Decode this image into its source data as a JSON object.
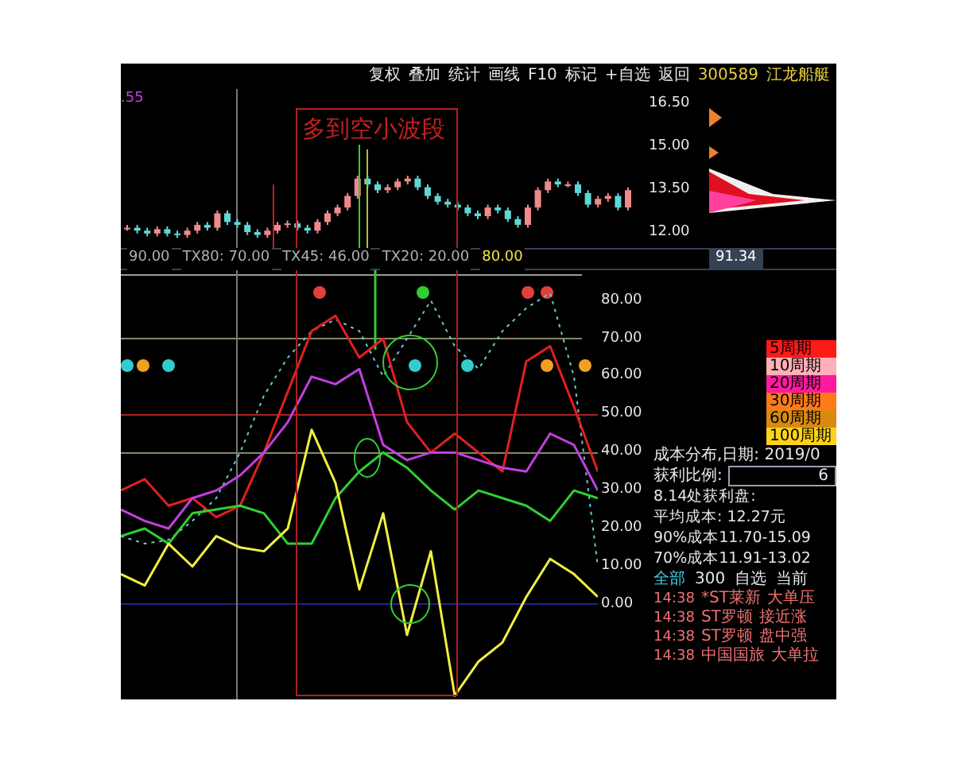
{
  "menu": [
    {
      "label": "复权"
    },
    {
      "label": "叠加"
    },
    {
      "label": "统计"
    },
    {
      "label": "画线"
    },
    {
      "label": "F10"
    },
    {
      "label": "标记"
    },
    {
      "label": "+自选"
    },
    {
      "label": "返回"
    }
  ],
  "stock": {
    "code": "300589",
    "name": "江龙船艇"
  },
  "price_chart": {
    "corner_value": ".55",
    "chart_data": {
      "type": "candlestick",
      "ylim": [
        11.5,
        17
      ],
      "yticks": [
        {
          "value": 16.5,
          "label": "16.50"
        },
        {
          "value": 15,
          "label": "15.00"
        },
        {
          "value": 13.5,
          "label": "13.50"
        },
        {
          "value": 12,
          "label": "12.00"
        }
      ],
      "ohlc": [
        [
          12.15,
          12.3,
          12.1,
          12.2
        ],
        [
          12.2,
          12.3,
          12.0,
          12.1
        ],
        [
          12.1,
          12.2,
          11.9,
          12.0
        ],
        [
          12.0,
          12.25,
          11.9,
          12.15
        ],
        [
          12.15,
          12.25,
          11.9,
          12.0
        ],
        [
          12.0,
          12.1,
          11.85,
          11.95
        ],
        [
          11.95,
          12.2,
          11.85,
          12.1
        ],
        [
          12.1,
          12.4,
          12.0,
          12.3
        ],
        [
          12.3,
          12.4,
          12.1,
          12.2
        ],
        [
          12.2,
          12.8,
          12.1,
          12.7
        ],
        [
          12.7,
          12.8,
          12.3,
          12.4
        ],
        [
          12.4,
          12.5,
          12.2,
          12.3
        ],
        [
          12.3,
          12.4,
          11.95,
          12.05
        ],
        [
          12.05,
          12.15,
          11.85,
          11.95
        ],
        [
          11.95,
          12.2,
          11.85,
          12.1
        ],
        [
          12.1,
          12.4,
          12.0,
          12.3
        ],
        [
          12.3,
          12.45,
          12.2,
          12.35
        ],
        [
          12.35,
          12.45,
          12.1,
          12.2
        ],
        [
          12.2,
          12.3,
          12.0,
          12.1
        ],
        [
          12.1,
          12.5,
          12.0,
          12.4
        ],
        [
          12.4,
          12.8,
          12.3,
          12.7
        ],
        [
          12.7,
          13.0,
          12.6,
          12.9
        ],
        [
          12.9,
          13.4,
          12.8,
          13.3
        ],
        [
          13.3,
          14.0,
          13.2,
          13.9
        ],
        [
          13.9,
          14.0,
          13.6,
          13.7
        ],
        [
          13.7,
          13.8,
          13.4,
          13.5
        ],
        [
          13.5,
          13.7,
          13.4,
          13.6
        ],
        [
          13.6,
          13.9,
          13.5,
          13.8
        ],
        [
          13.8,
          14.0,
          13.7,
          13.9
        ],
        [
          13.9,
          14.0,
          13.5,
          13.6
        ],
        [
          13.6,
          13.7,
          13.2,
          13.3
        ],
        [
          13.3,
          13.4,
          13.0,
          13.1
        ],
        [
          13.1,
          13.2,
          12.9,
          13.0
        ],
        [
          13.0,
          13.1,
          12.8,
          12.9
        ],
        [
          12.9,
          13.0,
          12.6,
          12.7
        ],
        [
          12.7,
          12.8,
          12.5,
          12.6
        ],
        [
          12.6,
          13.0,
          12.5,
          12.9
        ],
        [
          12.9,
          13.0,
          12.7,
          12.8
        ],
        [
          12.8,
          12.9,
          12.4,
          12.5
        ],
        [
          12.5,
          12.6,
          12.2,
          12.3
        ],
        [
          12.3,
          13.0,
          12.2,
          12.9
        ],
        [
          12.9,
          13.6,
          12.8,
          13.5
        ],
        [
          13.5,
          13.9,
          13.4,
          13.8
        ],
        [
          13.8,
          13.9,
          13.6,
          13.7
        ],
        [
          13.65,
          13.8,
          13.6,
          13.7
        ],
        [
          13.7,
          13.8,
          13.3,
          13.4
        ],
        [
          13.4,
          13.5,
          12.9,
          13.0
        ],
        [
          13.0,
          13.3,
          12.9,
          13.2
        ],
        [
          13.2,
          13.4,
          13.1,
          13.3
        ],
        [
          13.3,
          13.4,
          12.8,
          12.9
        ],
        [
          12.9,
          13.6,
          12.8,
          13.5
        ]
      ]
    }
  },
  "highlight": {
    "title": "多到空小波段"
  },
  "indicator_header": {
    "items": [
      {
        "text": "90.00",
        "color": "#b0b0b0"
      },
      {
        "text": "TX80: 70.00",
        "color": "#b0b0b0"
      },
      {
        "text": "TX45: 46.00",
        "color": "#b0b0b0"
      },
      {
        "text": "TX20: 20.00",
        "color": "#b0b0b0"
      },
      {
        "text": "80.00",
        "color": "#f5e642"
      }
    ],
    "value": "91.34"
  },
  "indicator": {
    "chart_data": {
      "type": "line",
      "ylim": [
        -25,
        88
      ],
      "yticks": [
        {
          "value": 80,
          "label": "80.00"
        },
        {
          "value": 70,
          "label": "70.00"
        },
        {
          "value": 60,
          "label": "60.00"
        },
        {
          "value": 50,
          "label": "50.00"
        },
        {
          "value": 40,
          "label": "40.00"
        },
        {
          "value": 30,
          "label": "30.00"
        },
        {
          "value": 20,
          "label": "20.00"
        },
        {
          "value": 10,
          "label": "10.00"
        },
        {
          "value": 0,
          "label": "0.00"
        }
      ],
      "series": [
        {
          "color": "#66cccc",
          "line_style": "dashed",
          "values": [
            18,
            16,
            17,
            22,
            28,
            40,
            55,
            65,
            72,
            75,
            72,
            60,
            70,
            80,
            68,
            62,
            72,
            78,
            82,
            60,
            10
          ]
        },
        {
          "color": "#e02020",
          "values": [
            30,
            33,
            26,
            28,
            23,
            26,
            40,
            56,
            72,
            76,
            65,
            70,
            48,
            40,
            45,
            40,
            35,
            64,
            68,
            52,
            35
          ]
        },
        {
          "color": "#c040e0",
          "values": [
            25,
            22,
            20,
            28,
            30,
            34,
            40,
            48,
            60,
            58,
            62,
            42,
            38,
            40,
            40,
            38,
            36,
            35,
            45,
            42,
            30
          ]
        },
        {
          "color": "#30d030",
          "values": [
            18,
            20,
            16,
            24,
            25,
            26,
            24,
            16,
            16,
            28,
            35,
            40,
            36,
            30,
            25,
            30,
            28,
            26,
            22,
            30,
            28
          ]
        },
        {
          "color": "#f0f040",
          "values": [
            8,
            5,
            16,
            10,
            18,
            15,
            14,
            20,
            46,
            32,
            4,
            24,
            -8,
            14,
            -24,
            -15,
            -10,
            2,
            12,
            8,
            2
          ]
        }
      ]
    }
  },
  "legend": [
    {
      "label": "5周期",
      "color": "#ff1a1a"
    },
    {
      "label": "10周期",
      "color": "#ffb0b8"
    },
    {
      "label": "20周期",
      "color": "#ff1aa0"
    },
    {
      "label": "30周期",
      "color": "#ff7a1a"
    },
    {
      "label": "60周期",
      "color": "#d98a10"
    },
    {
      "label": "100周期",
      "color": "#ffd21a"
    }
  ],
  "cost": {
    "title": "成本分布,日期: 2019/0",
    "profit_label": "获利比例:",
    "profit_value": "6",
    "lines": [
      "8.14处获利盘:",
      "平均成本: 12.27元",
      "90%成本11.70-15.09",
      "70%成本11.91-13.02"
    ]
  },
  "watch_tabs": [
    {
      "label": "全部",
      "selected": true
    },
    {
      "label": "300",
      "selected": false
    },
    {
      "label": "自选",
      "selected": false
    },
    {
      "label": "当前",
      "selected": false
    }
  ],
  "alerts": [
    {
      "time": "14:38",
      "name": "*ST莱新",
      "event": "大单压"
    },
    {
      "time": "14:38",
      "name": "ST罗顿",
      "event": "接近涨"
    },
    {
      "time": "14:38",
      "name": "ST罗顿",
      "event": "盘中强"
    },
    {
      "time": "14:38",
      "name": "中国国旅",
      "event": "大单拉"
    }
  ]
}
